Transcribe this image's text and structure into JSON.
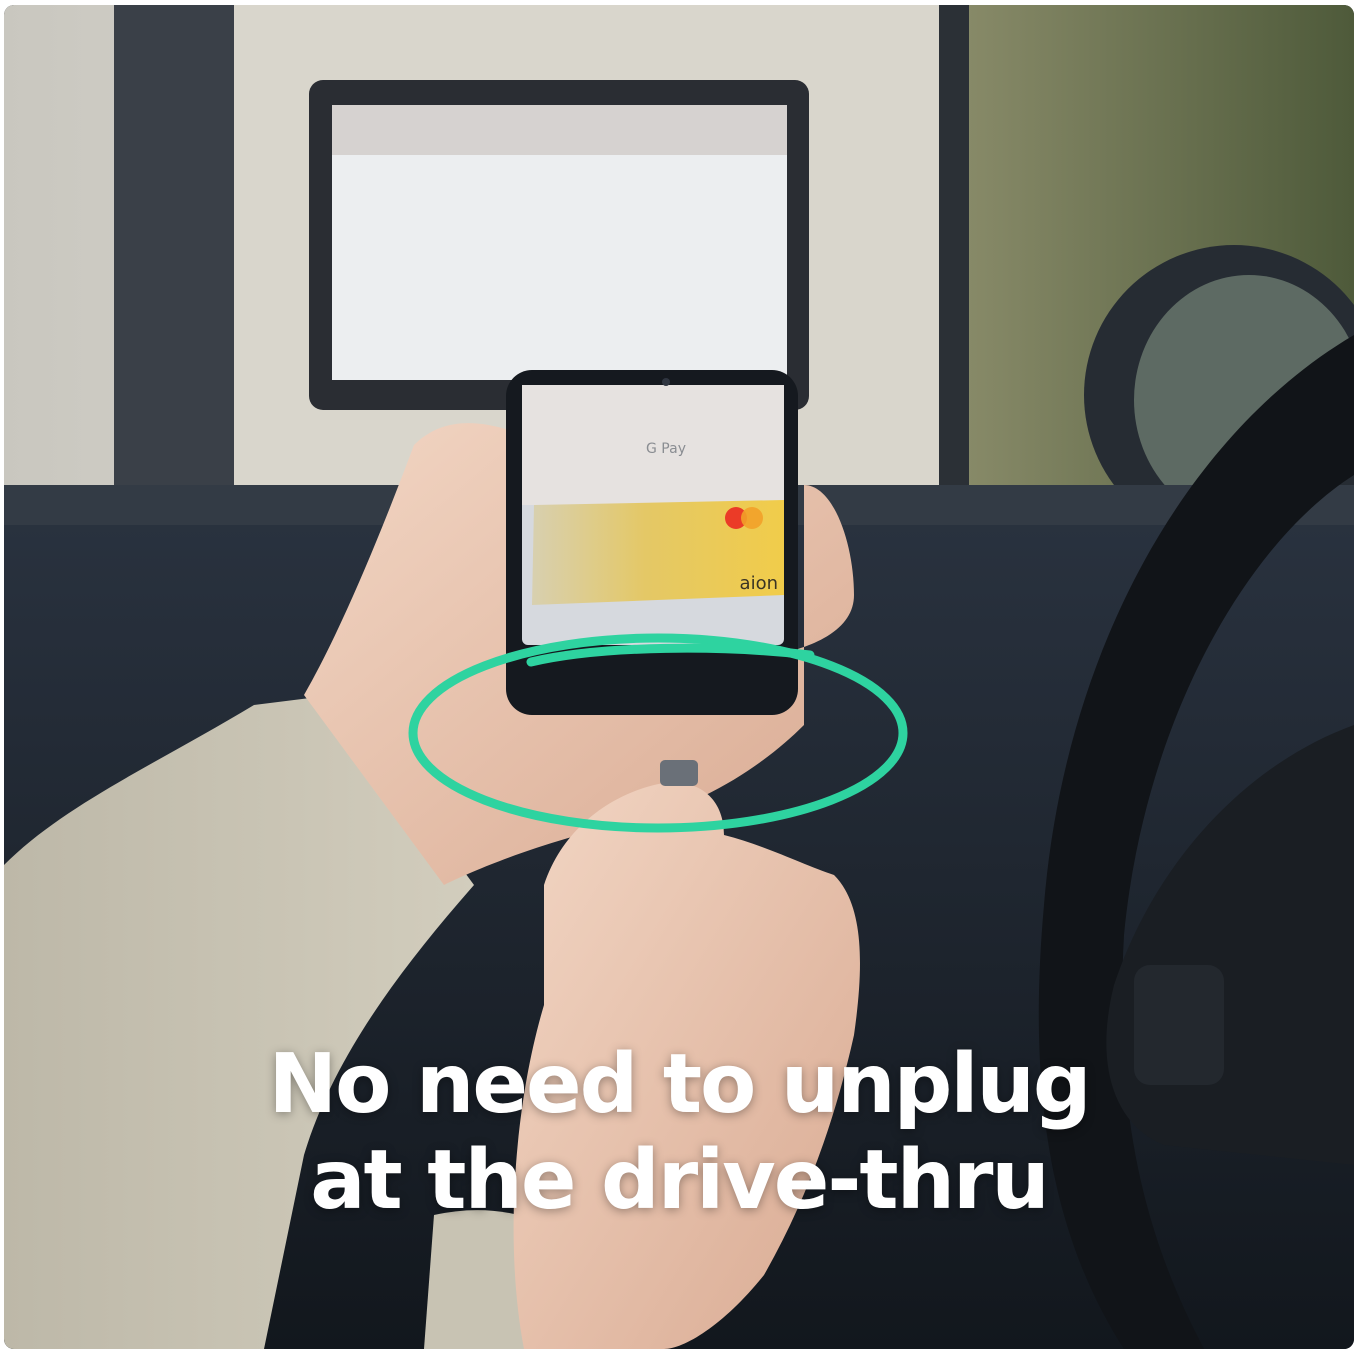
{
  "photo": {
    "accent_color": "#2ed3a0",
    "card_brand": "aion",
    "wallet_label": "G Pay"
  },
  "caption": {
    "line1": "No need to unplug",
    "line2": "at the drive-thru"
  }
}
